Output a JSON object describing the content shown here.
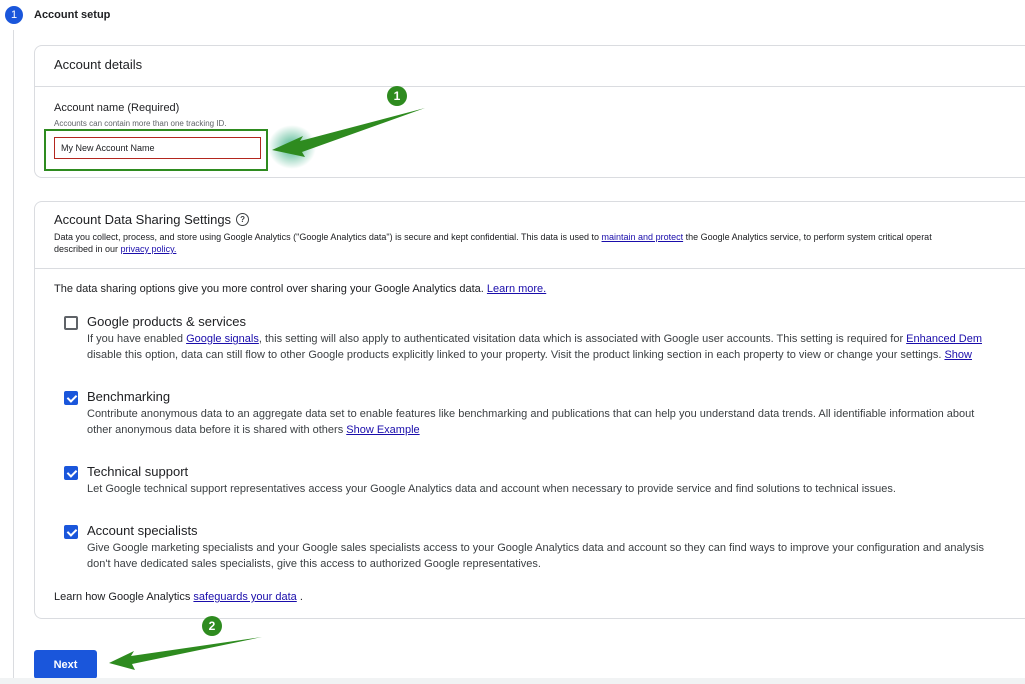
{
  "step": {
    "number": "1",
    "title": "Account setup"
  },
  "account_details": {
    "title": "Account details",
    "field_label": "Account name (Required)",
    "field_hint": "Accounts can contain more than one tracking ID.",
    "field_value": "My New Account Name"
  },
  "sharing": {
    "title": "Account Data Sharing Settings",
    "desc_line1_a": "Data you collect, process, and store using Google Analytics (\"Google Analytics data\") is secure and kept confidential. This data is used to ",
    "desc_link1": "maintain and protect",
    "desc_line1_b": " the Google Analytics service, to perform system critical operat",
    "desc_line2_a": "described in our ",
    "desc_link2": "privacy policy.",
    "intro_text": "The data sharing options give you more control over sharing your Google Analytics data. ",
    "intro_link": "Learn more.",
    "options": [
      {
        "title": "Google products & services",
        "checked": false,
        "line1_a": "If you have enabled ",
        "line1_link": "Google signals",
        "line1_b": ", this setting will also apply to authenticated visitation data which is associated with Google user accounts. This setting is required for ",
        "line1_link2": "Enhanced Dem",
        "line2_a": "disable this option, data can still flow to other Google products explicitly linked to your property. Visit the product linking section in each property to view or change your settings.  ",
        "line2_link": "Show"
      },
      {
        "title": "Benchmarking",
        "checked": true,
        "line1_a": "Contribute anonymous data to an aggregate data set to enable features like benchmarking and publications that can help you understand data trends. All identifiable information about",
        "line2_a": "other anonymous data before it is shared with others  ",
        "line2_link": "Show Example"
      },
      {
        "title": "Technical support",
        "checked": true,
        "line1_a": "Let Google technical support representatives access your Google Analytics data and account when necessary to provide service and find solutions to technical issues."
      },
      {
        "title": "Account specialists",
        "checked": true,
        "line1_a": "Give Google marketing specialists and your Google sales specialists access to your Google Analytics data and account so they can find ways to improve your configuration and analysis",
        "line2_a": "don't have dedicated sales specialists, give this access to authorized Google representatives."
      }
    ],
    "footer_a": "Learn how Google Analytics ",
    "footer_link": "safeguards your data",
    "footer_b": " ."
  },
  "next_label": "Next",
  "annotations": {
    "badge1": "1",
    "badge2": "2"
  },
  "colors": {
    "primary": "#1a56db",
    "annotation_green": "#2e8b1f",
    "error_red": "#b3261e"
  }
}
